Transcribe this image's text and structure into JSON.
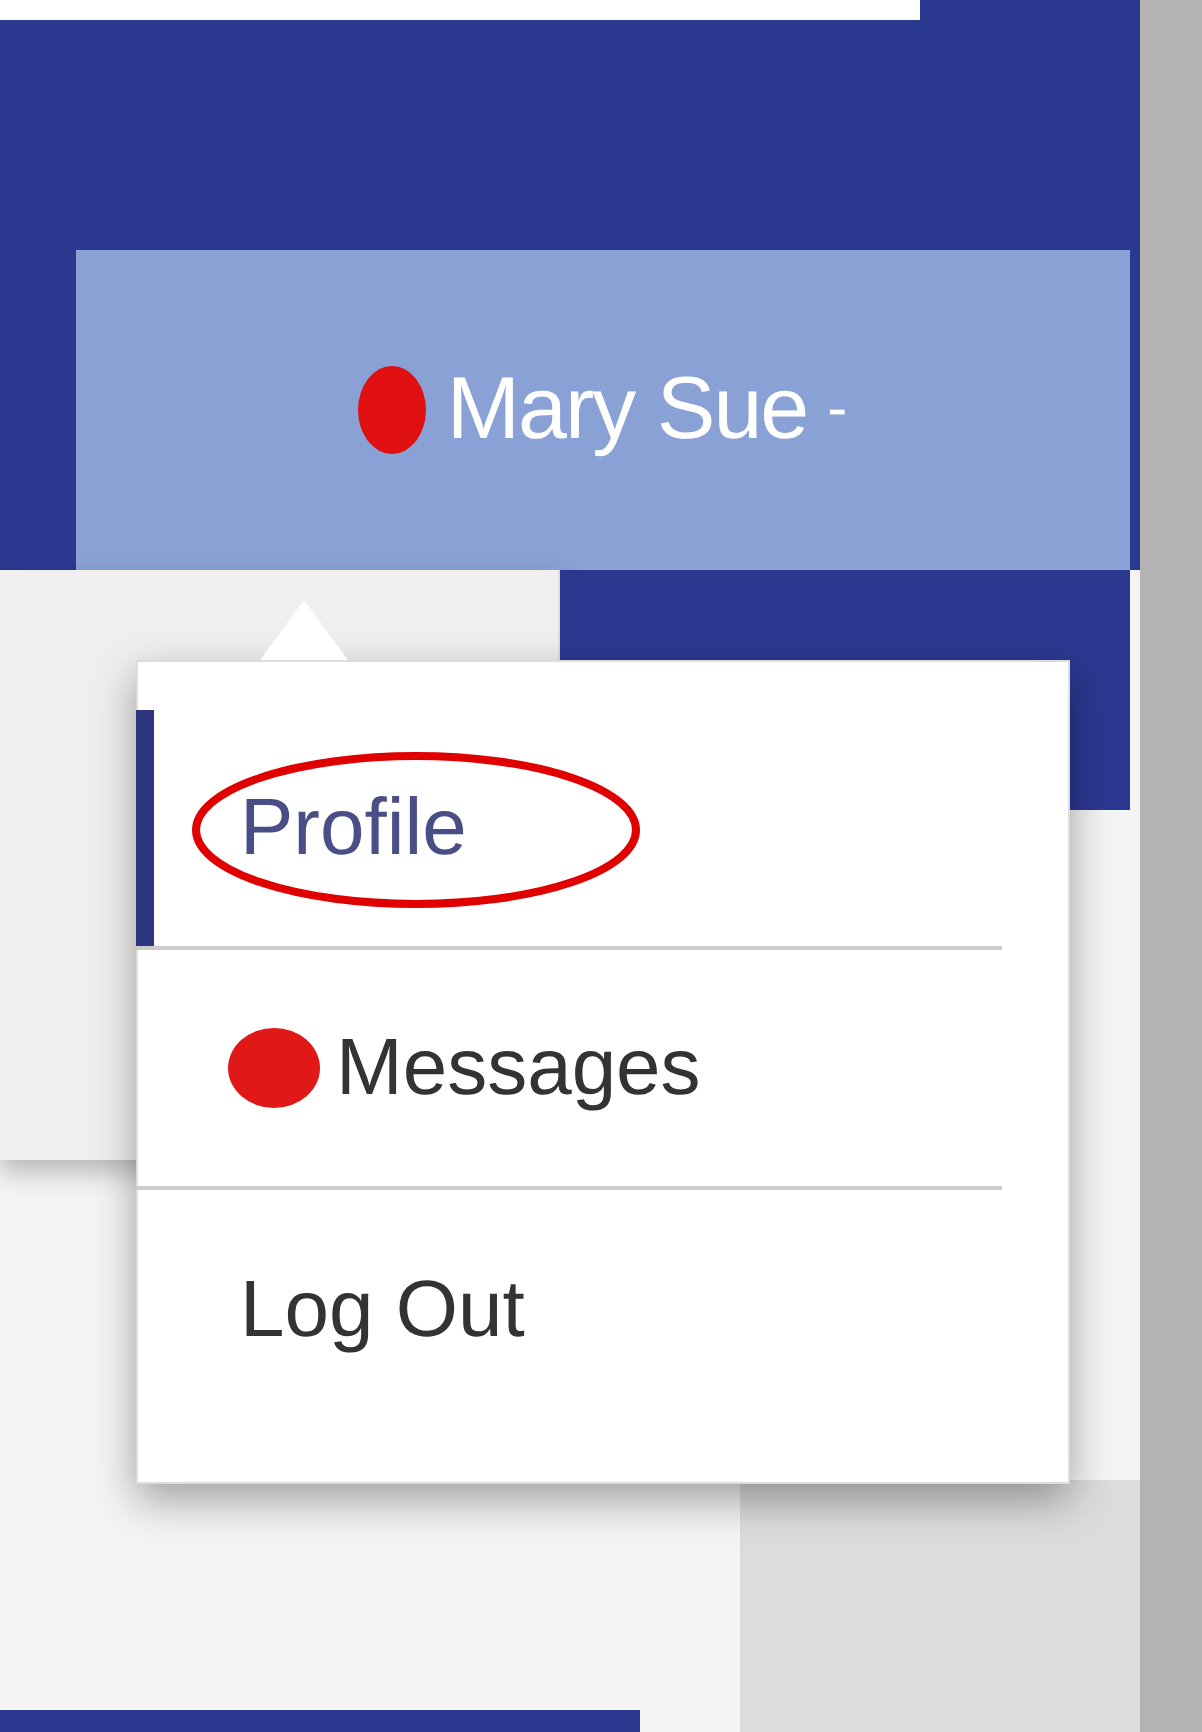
{
  "user_button": {
    "name": "Mary Sue",
    "caret": "-",
    "alert": true
  },
  "menu": {
    "items": [
      {
        "label": "Profile",
        "selected": true,
        "alert": false,
        "circled": true
      },
      {
        "label": "Messages",
        "selected": false,
        "alert": true,
        "circled": false
      },
      {
        "label": "Log Out",
        "selected": false,
        "alert": false,
        "circled": false
      }
    ]
  }
}
